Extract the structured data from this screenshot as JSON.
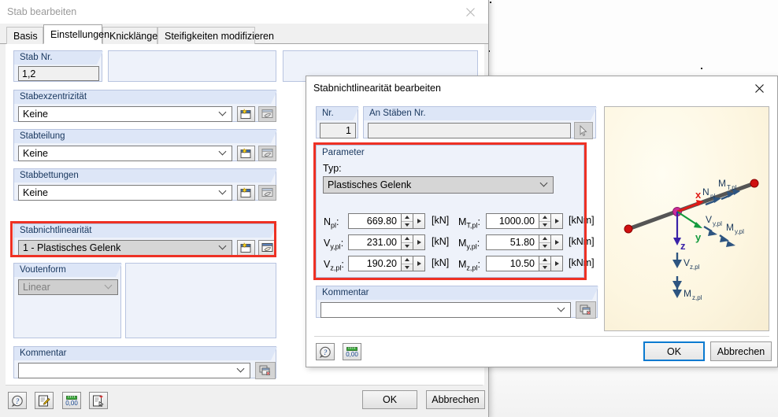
{
  "workspace": {
    "background_color": "#fcfcfc"
  },
  "dialog1": {
    "title": "Stab bearbeiten",
    "close_icon": "close-icon",
    "tabs": [
      {
        "label": "Basis",
        "selected": false
      },
      {
        "label": "Einstellungen",
        "selected": true
      },
      {
        "label": "Knicklängen",
        "selected": false
      },
      {
        "label": "Steifigkeiten modifizieren",
        "selected": false
      }
    ],
    "fields": {
      "stab_nr": {
        "label": "Stab Nr.",
        "value": "1,2"
      },
      "stabexzentrizitaet": {
        "label": "Stabexzentrizität",
        "value": "Keine"
      },
      "stabteilung": {
        "label": "Stabteilung",
        "value": "Keine"
      },
      "stabbettungen": {
        "label": "Stabbettungen",
        "value": "Keine"
      },
      "stabnichtlinearitaet": {
        "label": "Stabnichtlinearität",
        "value": "1 - Plastisches Gelenk"
      },
      "voutenform": {
        "label": "Voutenform",
        "value": "Linear"
      },
      "kommentar": {
        "label": "Kommentar",
        "value": ""
      }
    },
    "row_icons": {
      "new_icon": "new-window-icon",
      "edit_icon": "edit-hand-icon"
    },
    "comment_copy_icon": "copy-icon",
    "toolbar": [
      {
        "icon": "help-icon"
      },
      {
        "icon": "edit-note-icon"
      },
      {
        "icon": "units-icon"
      },
      {
        "icon": "delete-select-icon"
      }
    ],
    "buttons": {
      "ok": "OK",
      "cancel": "Abbrechen"
    },
    "highlight_color": "#ee3124"
  },
  "dialog2": {
    "title": "Stabnichtlinearität bearbeiten",
    "close_icon": "close-icon",
    "fields": {
      "nr": {
        "label": "Nr.",
        "value": "1"
      },
      "an_staeben_nr": {
        "label": "An Stäben Nr.",
        "value": "",
        "picker_icon": "pick-pointer-icon"
      }
    },
    "parameter": {
      "title": "Parameter",
      "typ_label": "Typ:",
      "typ_value": "Plastisches Gelenk",
      "rows": [
        {
          "label": "N",
          "sub": "pl",
          "value": "669.80",
          "unit": "[kN]"
        },
        {
          "label": "V",
          "sub": "y,pl",
          "value": "231.00",
          "unit": "[kN]"
        },
        {
          "label": "V",
          "sub": "z,pl",
          "value": "190.20",
          "unit": "[kN]"
        }
      ],
      "rows_right": [
        {
          "label": "M",
          "sub": "T,pl",
          "value": "1000.00",
          "unit": "[kNm]"
        },
        {
          "label": "M",
          "sub": "y,pl",
          "value": "51.80",
          "unit": "[kNm]"
        },
        {
          "label": "M",
          "sub": "z,pl",
          "value": "10.50",
          "unit": "[kNm]"
        }
      ]
    },
    "kommentar": {
      "label": "Kommentar",
      "value": "",
      "copy_icon": "copy-icon"
    },
    "toolbar": [
      {
        "icon": "help-icon"
      },
      {
        "icon": "units-icon"
      }
    ],
    "buttons": {
      "ok": "OK",
      "cancel": "Abbrechen"
    },
    "preview": {
      "axis_x": "x",
      "axis_y": "y",
      "axis_z": "z",
      "labels": [
        "N",
        "M",
        "V",
        "M",
        "V",
        "M"
      ],
      "annotations": [
        {
          "base": "N",
          "sub": "pl"
        },
        {
          "base": "M",
          "sub": "T,pl"
        },
        {
          "base": "V",
          "sub": "y,pl"
        },
        {
          "base": "M",
          "sub": "y,pl"
        },
        {
          "base": "V",
          "sub": "z,pl"
        },
        {
          "base": "M",
          "sub": "z,pl"
        }
      ],
      "colors": {
        "x_axis": "#e01b17",
        "y_axis": "#139a3d",
        "z_axis": "#3a22a8",
        "arrow": "#2d5480",
        "node": "#cc2b9a",
        "member": "#555555"
      }
    },
    "highlight_color": "#ee3124"
  }
}
